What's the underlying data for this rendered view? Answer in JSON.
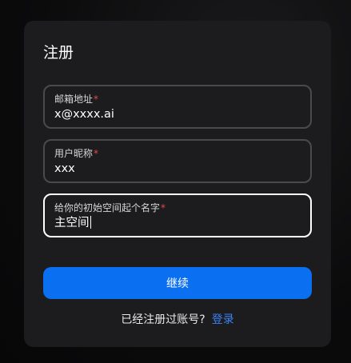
{
  "form": {
    "title": "注册",
    "required_mark": "*",
    "fields": [
      {
        "label": "邮箱地址",
        "value": "x@xxxx.ai"
      },
      {
        "label": "用户昵称",
        "value": "xxx"
      },
      {
        "label": "给你的初始空间起个名字",
        "value": "主空间"
      }
    ],
    "submit_label": "继续",
    "footer_prompt": "已经注册过账号?",
    "login_link": "登录"
  },
  "colors": {
    "accent": "#0a6ff0",
    "link": "#3b82f6",
    "required": "#e5484d",
    "card_background": "#1c1c1e"
  }
}
